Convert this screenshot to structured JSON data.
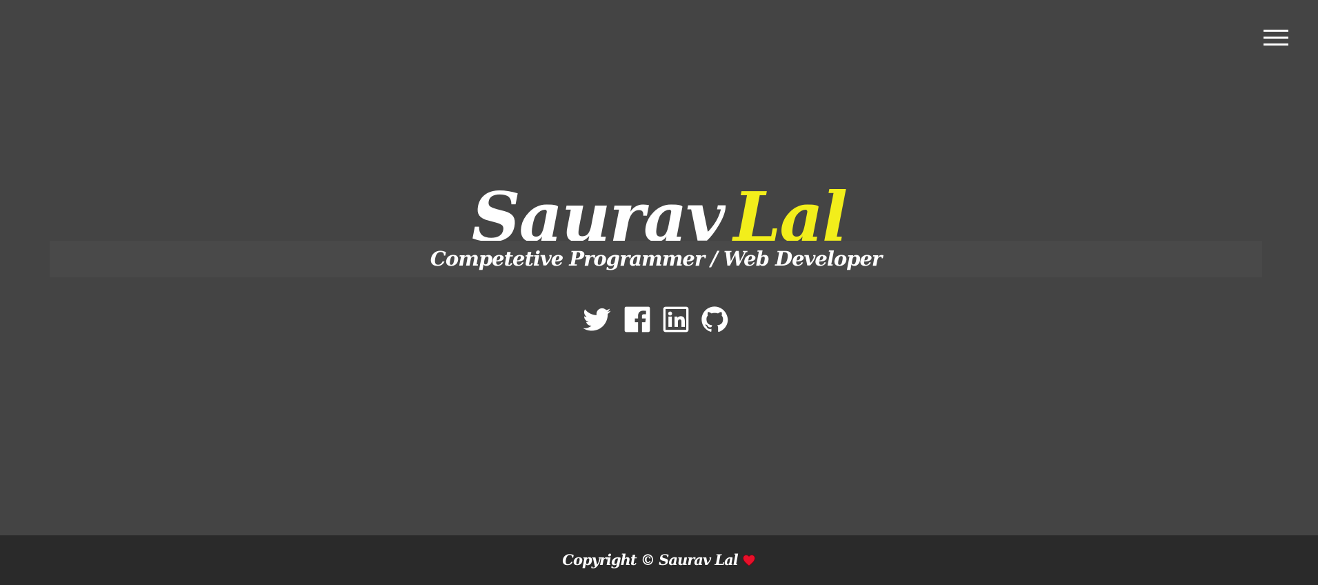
{
  "header": {
    "menu_icon": "hamburger-menu-icon"
  },
  "hero": {
    "first_name": "Saurav",
    "last_name": "Lal",
    "subtitle": "Competetive Programmer / Web Developer"
  },
  "social": [
    {
      "icon": "twitter-icon"
    },
    {
      "icon": "facebook-icon"
    },
    {
      "icon": "linkedin-icon"
    },
    {
      "icon": "github-icon"
    }
  ],
  "footer": {
    "text": "Copyright © Saurav Lal",
    "heart_icon": "heart-icon"
  },
  "colors": {
    "background": "#444444",
    "accent": "#f2ee1b",
    "footer_background": "#2a2a2a",
    "text": "#ffffff",
    "heart": "#e8102a"
  }
}
